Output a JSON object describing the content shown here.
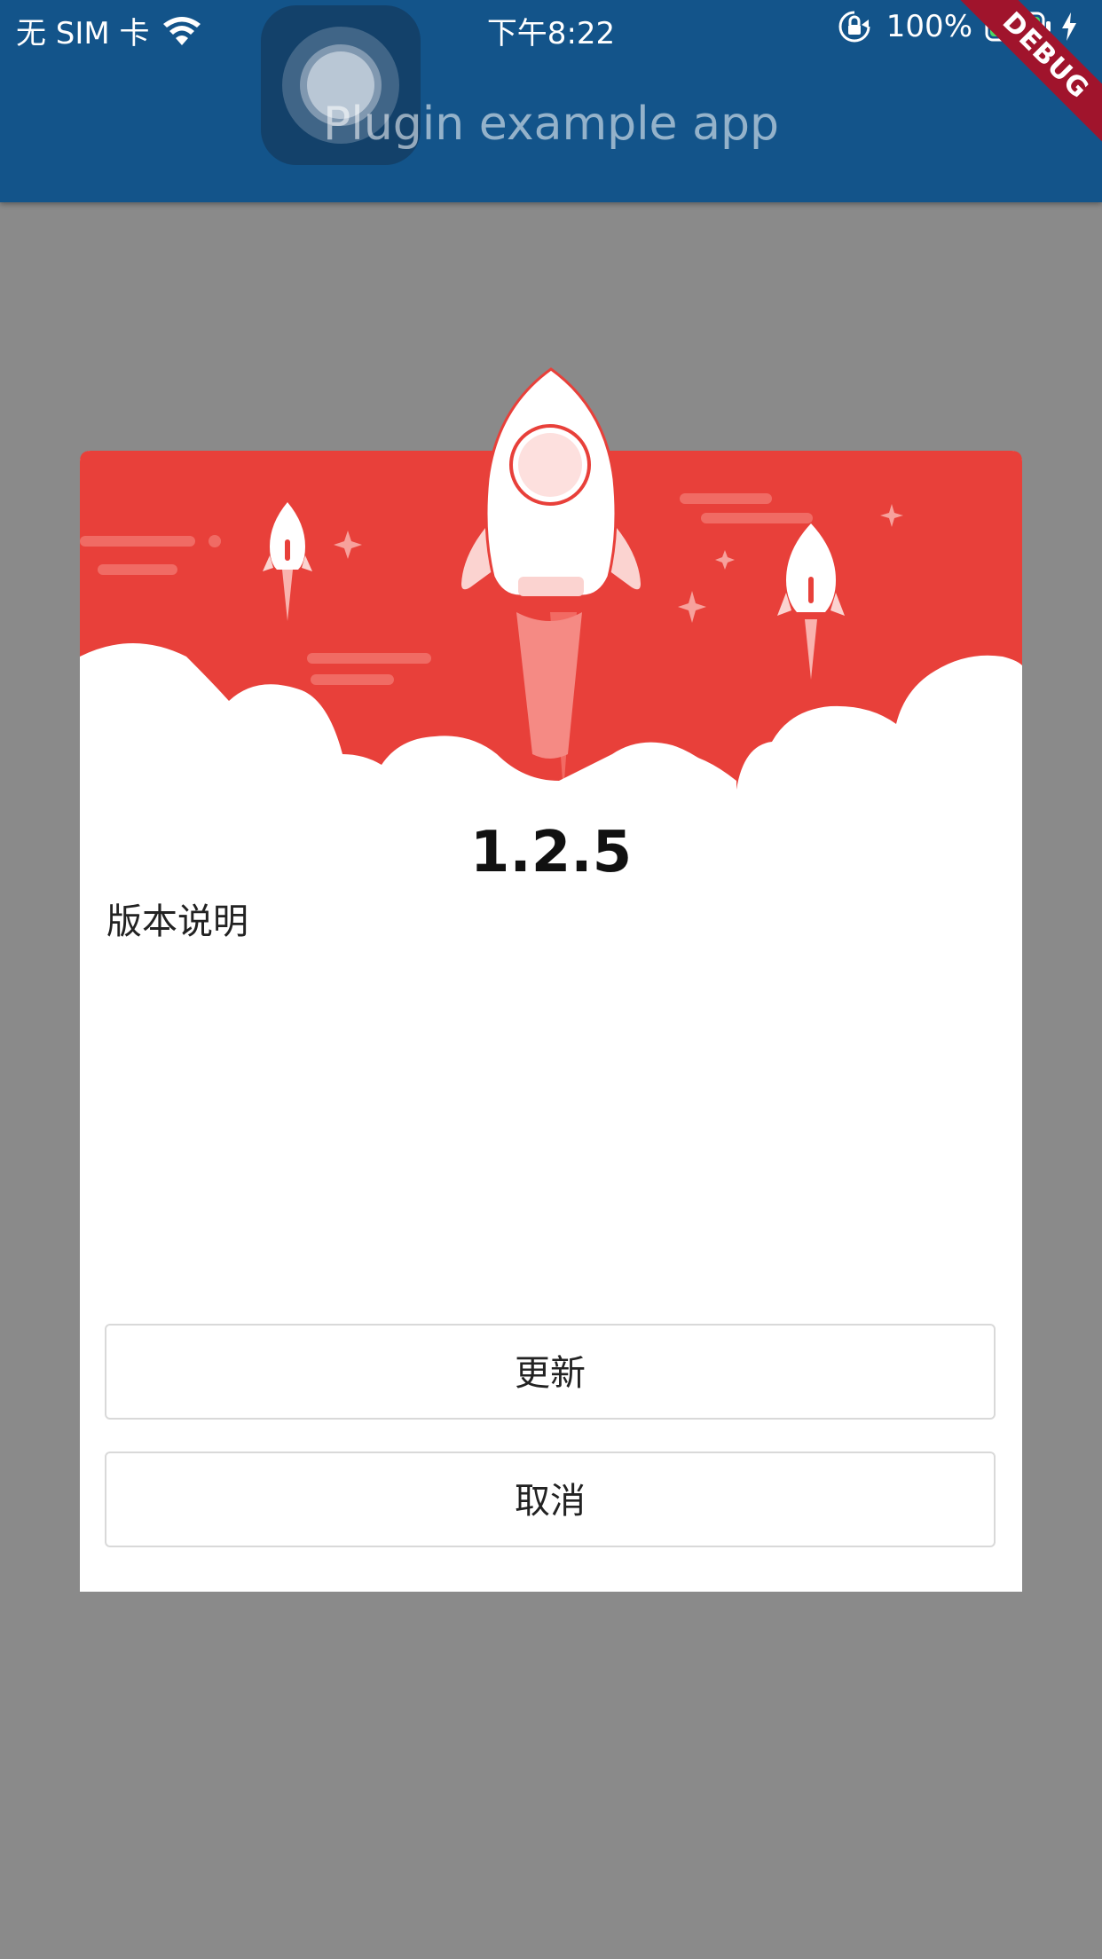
{
  "status_bar": {
    "carrier": "无 SIM 卡",
    "time": "下午8:22",
    "battery": "100%"
  },
  "app_bar": {
    "title": "Plugin example app",
    "debug_banner": "DEBUG"
  },
  "dialog": {
    "version": "1.2.5",
    "notes_label": "版本说明",
    "update_button": "更新",
    "cancel_button": "取消"
  },
  "colors": {
    "app_bar": "#13548a",
    "overlay": "#8a8a8a",
    "hero_red": "#e8403a",
    "debug": "#a0142c"
  },
  "icons": [
    "wifi-icon",
    "rotation-lock-icon",
    "battery-icon",
    "charging-bolt-icon",
    "assistive-touch-icon",
    "rocket-illustration"
  ]
}
